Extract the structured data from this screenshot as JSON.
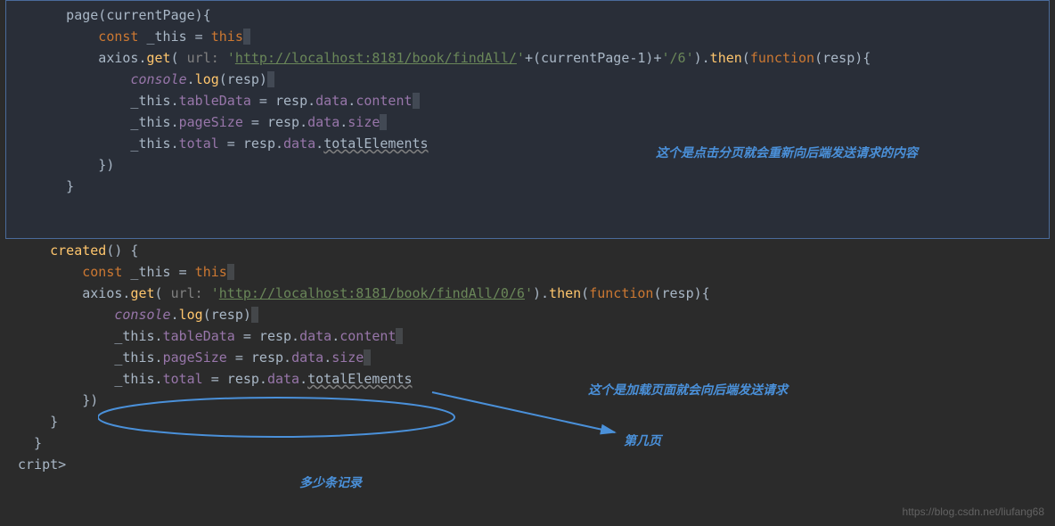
{
  "code": {
    "l1_a": "      page(currentPage){",
    "l2_kw": "          const",
    "l2_b": " _this = ",
    "l2_kw2": "this",
    "l3_a": "          axios.",
    "l3_fn": "get",
    "l3_b": "( ",
    "l3_hint": "url: ",
    "l3_str1": "'",
    "l3_url": "http://localhost:8181/book/findAll/",
    "l3_str2": "'",
    "l3_c": "+(currentPage-1)+",
    "l3_str3": "'/6'",
    "l3_d": ").",
    "l3_fn2": "then",
    "l3_e": "(",
    "l3_kw3": "function",
    "l3_f": "(resp){",
    "l4_a": "              ",
    "l4_console": "console",
    "l4_b": ".",
    "l4_fn": "log",
    "l4_c": "(resp)",
    "l5_a": "              _this.",
    "l5_p": "tableData",
    "l5_b": " = resp.",
    "l5_p2": "data",
    "l5_c": ".",
    "l5_p3": "content",
    "l6_a": "              _this.",
    "l6_p": "pageSize",
    "l6_b": " = resp.",
    "l6_p2": "data",
    "l6_c": ".",
    "l6_p3": "size",
    "l7_a": "              _this.",
    "l7_p": "total",
    "l7_b": " = resp.",
    "l7_p2": "data",
    "l7_c": ".",
    "l7_warn": "totalElements",
    "l8": "          })",
    "l9": "      }",
    "l11_fn": "    created",
    "l11_b": "() {",
    "l12_kw": "        const",
    "l12_b": " _this = ",
    "l12_kw2": "this",
    "l13_a": "        axios.",
    "l13_fn": "get",
    "l13_b": "( ",
    "l13_hint": "url: ",
    "l13_str1": "'",
    "l13_url": "http://localhost:8181/book/findAll/0/6",
    "l13_str2": "'",
    "l13_c": ").",
    "l13_fn2": "then",
    "l13_d": "(",
    "l13_kw3": "function",
    "l13_e": "(resp){",
    "l14_a": "            ",
    "l14_console": "console",
    "l14_b": ".",
    "l14_fn": "log",
    "l14_c": "(resp)",
    "l15_a": "            _this.",
    "l15_p": "tableData",
    "l15_b": " = resp.",
    "l15_p2": "data",
    "l15_c": ".",
    "l15_p3": "content",
    "l16_a": "            _this.",
    "l16_p": "pageSize",
    "l16_b": " = resp.",
    "l16_p2": "data",
    "l16_c": ".",
    "l16_p3": "size",
    "l17_a": "            _this.",
    "l17_p": "total",
    "l17_b": " = resp.",
    "l17_p2": "data",
    "l17_c": ".",
    "l17_warn": "totalElements",
    "l18": "        })",
    "l19": "    }",
    "l20": "  }",
    "l21": "cript>"
  },
  "annotations": {
    "a1": "这个是点击分页就会重新向后端发送请求的内容",
    "a2": "这个是加载页面就会向后端发送请求",
    "a3": "第几页",
    "a4": "多少条记录"
  },
  "watermark": "https://blog.csdn.net/liufang68"
}
